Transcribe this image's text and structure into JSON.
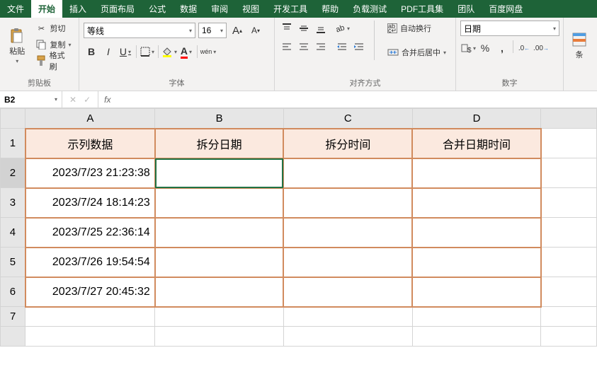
{
  "tabs": {
    "file": "文件",
    "items": [
      "开始",
      "插入",
      "页面布局",
      "公式",
      "数据",
      "审阅",
      "视图",
      "开发工具",
      "帮助",
      "负载测试",
      "PDF工具集",
      "团队",
      "百度网盘"
    ],
    "active_index": 0
  },
  "ribbon": {
    "clipboard": {
      "paste": "粘贴",
      "cut": "剪切",
      "copy": "复制",
      "format_painter": "格式刷",
      "group_label": "剪贴板"
    },
    "font": {
      "name": "等线",
      "size": "16",
      "bold": "B",
      "italic": "I",
      "underline": "U",
      "phonetic": "wén",
      "inc": "A",
      "dec": "A",
      "group_label": "字体"
    },
    "alignment": {
      "wrap": "自动换行",
      "merge": "合并后居中",
      "group_label": "对齐方式"
    },
    "number": {
      "format": "日期",
      "group_label": "数字"
    },
    "styles": {
      "cond": "条"
    }
  },
  "namebox": {
    "cell": "B2"
  },
  "columns": [
    "A",
    "B",
    "C",
    "D"
  ],
  "headers": [
    "示列数据",
    "拆分日期",
    "拆分时间",
    "合并日期时间"
  ],
  "rows": [
    {
      "num": "1"
    },
    {
      "num": "2",
      "a": "2023/7/23 21:23:38"
    },
    {
      "num": "3",
      "a": "2023/7/24 18:14:23"
    },
    {
      "num": "4",
      "a": "2023/7/25 22:36:14"
    },
    {
      "num": "5",
      "a": "2023/7/26 19:54:54"
    },
    {
      "num": "6",
      "a": "2023/7/27 20:45:32"
    },
    {
      "num": "7"
    }
  ],
  "selected_cell": "B2"
}
